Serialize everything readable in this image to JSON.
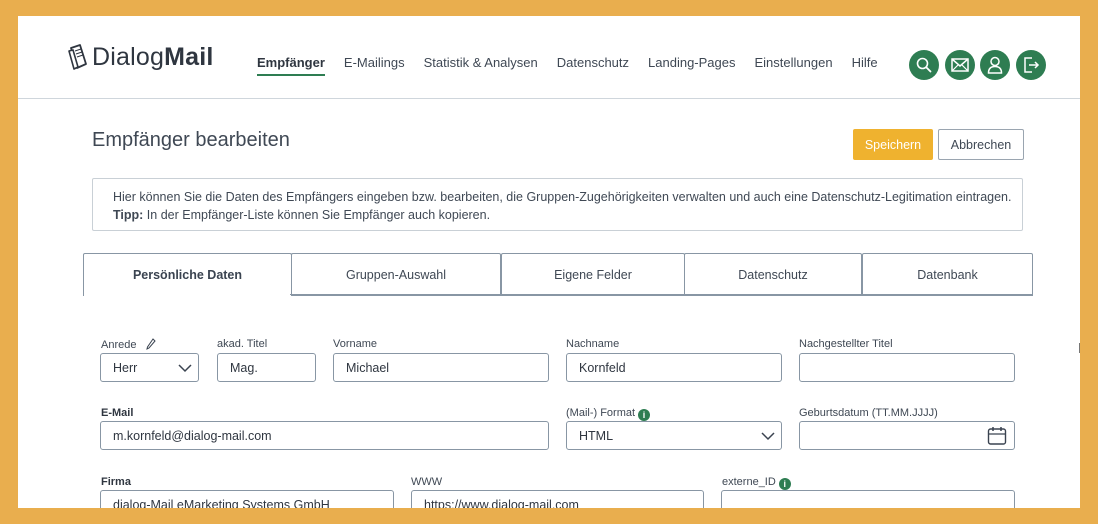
{
  "brand": {
    "logo_regular": "Dialog",
    "logo_bold": "Mail"
  },
  "nav": [
    {
      "label": "Empfänger",
      "active": true
    },
    {
      "label": "E-Mailings"
    },
    {
      "label": "Statistik & Analysen"
    },
    {
      "label": "Datenschutz"
    },
    {
      "label": "Landing-Pages"
    },
    {
      "label": "Einstellungen"
    },
    {
      "label": "Hilfe"
    }
  ],
  "header_icons": [
    "search-icon",
    "mail-icon",
    "user-icon",
    "logout-icon"
  ],
  "page": {
    "title": "Empfänger bearbeiten",
    "save_label": "Speichern",
    "cancel_label": "Abbrechen"
  },
  "info": {
    "line1": "Hier können Sie die Daten des Empfängers eingeben bzw. bearbeiten, die Gruppen-Zugehörigkeiten verwalten und auch eine Datenschutz-Legitimation eintragen.",
    "tip_label": "Tipp:",
    "tip_text": " In der Empfänger-Liste können Sie Empfänger auch kopieren."
  },
  "tabs": [
    "Persönliche Daten",
    "Gruppen-Auswahl",
    "Eigene Felder",
    "Datenschutz",
    "Datenbank"
  ],
  "form": {
    "anrede": {
      "label": "Anrede",
      "value": "Herr"
    },
    "titel": {
      "label": "akad. Titel",
      "value": "Mag."
    },
    "vorname": {
      "label": "Vorname",
      "value": "Michael"
    },
    "nachname": {
      "label": "Nachname",
      "value": "Kornfeld"
    },
    "nachtitel": {
      "label": "Nachgestellter Titel",
      "value": ""
    },
    "email": {
      "label": "E-Mail",
      "value": "m.kornfeld@dialog-mail.com"
    },
    "format": {
      "label": "(Mail-) Format",
      "value": "HTML"
    },
    "geburtsdatum": {
      "label": "Geburtsdatum (TT.MM.JJJJ)",
      "value": ""
    },
    "firma": {
      "label": "Firma",
      "value": "dialog-Mail eMarketing Systems GmbH"
    },
    "www": {
      "label": "WWW",
      "value": "https://www.dialog-mail.com"
    },
    "extern": {
      "label": "externe_ID",
      "value": ""
    }
  },
  "colors": {
    "accent_green": "#2e7d52",
    "save_yellow": "#efb22f",
    "frame_orange": "#e9ae4e"
  }
}
